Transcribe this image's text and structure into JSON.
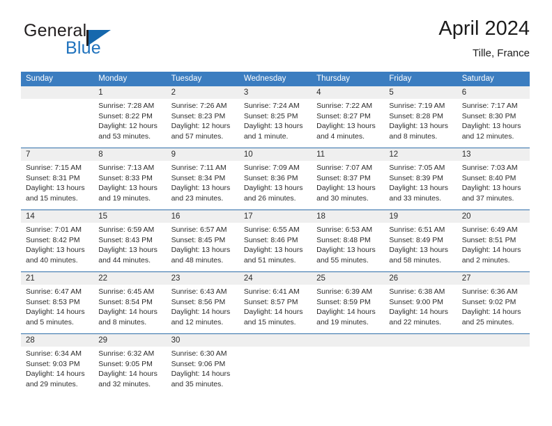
{
  "brand": {
    "name_top": "General",
    "name_bottom": "Blue",
    "accent_color": "#1f72bd"
  },
  "header": {
    "month_title": "April 2024",
    "location": "Tille, France"
  },
  "calendar": {
    "header_color": "#3b7dc0",
    "daynum_strip_color": "#efefef",
    "weekday_names": [
      "Sunday",
      "Monday",
      "Tuesday",
      "Wednesday",
      "Thursday",
      "Friday",
      "Saturday"
    ],
    "weeks": [
      {
        "days": [
          {
            "num": "",
            "lines": []
          },
          {
            "num": "1",
            "lines": [
              "Sunrise: 7:28 AM",
              "Sunset: 8:22 PM",
              "Daylight: 12 hours",
              "and 53 minutes."
            ]
          },
          {
            "num": "2",
            "lines": [
              "Sunrise: 7:26 AM",
              "Sunset: 8:23 PM",
              "Daylight: 12 hours",
              "and 57 minutes."
            ]
          },
          {
            "num": "3",
            "lines": [
              "Sunrise: 7:24 AM",
              "Sunset: 8:25 PM",
              "Daylight: 13 hours",
              "and 1 minute."
            ]
          },
          {
            "num": "4",
            "lines": [
              "Sunrise: 7:22 AM",
              "Sunset: 8:27 PM",
              "Daylight: 13 hours",
              "and 4 minutes."
            ]
          },
          {
            "num": "5",
            "lines": [
              "Sunrise: 7:19 AM",
              "Sunset: 8:28 PM",
              "Daylight: 13 hours",
              "and 8 minutes."
            ]
          },
          {
            "num": "6",
            "lines": [
              "Sunrise: 7:17 AM",
              "Sunset: 8:30 PM",
              "Daylight: 13 hours",
              "and 12 minutes."
            ]
          }
        ]
      },
      {
        "days": [
          {
            "num": "7",
            "lines": [
              "Sunrise: 7:15 AM",
              "Sunset: 8:31 PM",
              "Daylight: 13 hours",
              "and 15 minutes."
            ]
          },
          {
            "num": "8",
            "lines": [
              "Sunrise: 7:13 AM",
              "Sunset: 8:33 PM",
              "Daylight: 13 hours",
              "and 19 minutes."
            ]
          },
          {
            "num": "9",
            "lines": [
              "Sunrise: 7:11 AM",
              "Sunset: 8:34 PM",
              "Daylight: 13 hours",
              "and 23 minutes."
            ]
          },
          {
            "num": "10",
            "lines": [
              "Sunrise: 7:09 AM",
              "Sunset: 8:36 PM",
              "Daylight: 13 hours",
              "and 26 minutes."
            ]
          },
          {
            "num": "11",
            "lines": [
              "Sunrise: 7:07 AM",
              "Sunset: 8:37 PM",
              "Daylight: 13 hours",
              "and 30 minutes."
            ]
          },
          {
            "num": "12",
            "lines": [
              "Sunrise: 7:05 AM",
              "Sunset: 8:39 PM",
              "Daylight: 13 hours",
              "and 33 minutes."
            ]
          },
          {
            "num": "13",
            "lines": [
              "Sunrise: 7:03 AM",
              "Sunset: 8:40 PM",
              "Daylight: 13 hours",
              "and 37 minutes."
            ]
          }
        ]
      },
      {
        "days": [
          {
            "num": "14",
            "lines": [
              "Sunrise: 7:01 AM",
              "Sunset: 8:42 PM",
              "Daylight: 13 hours",
              "and 40 minutes."
            ]
          },
          {
            "num": "15",
            "lines": [
              "Sunrise: 6:59 AM",
              "Sunset: 8:43 PM",
              "Daylight: 13 hours",
              "and 44 minutes."
            ]
          },
          {
            "num": "16",
            "lines": [
              "Sunrise: 6:57 AM",
              "Sunset: 8:45 PM",
              "Daylight: 13 hours",
              "and 48 minutes."
            ]
          },
          {
            "num": "17",
            "lines": [
              "Sunrise: 6:55 AM",
              "Sunset: 8:46 PM",
              "Daylight: 13 hours",
              "and 51 minutes."
            ]
          },
          {
            "num": "18",
            "lines": [
              "Sunrise: 6:53 AM",
              "Sunset: 8:48 PM",
              "Daylight: 13 hours",
              "and 55 minutes."
            ]
          },
          {
            "num": "19",
            "lines": [
              "Sunrise: 6:51 AM",
              "Sunset: 8:49 PM",
              "Daylight: 13 hours",
              "and 58 minutes."
            ]
          },
          {
            "num": "20",
            "lines": [
              "Sunrise: 6:49 AM",
              "Sunset: 8:51 PM",
              "Daylight: 14 hours",
              "and 2 minutes."
            ]
          }
        ]
      },
      {
        "days": [
          {
            "num": "21",
            "lines": [
              "Sunrise: 6:47 AM",
              "Sunset: 8:53 PM",
              "Daylight: 14 hours",
              "and 5 minutes."
            ]
          },
          {
            "num": "22",
            "lines": [
              "Sunrise: 6:45 AM",
              "Sunset: 8:54 PM",
              "Daylight: 14 hours",
              "and 8 minutes."
            ]
          },
          {
            "num": "23",
            "lines": [
              "Sunrise: 6:43 AM",
              "Sunset: 8:56 PM",
              "Daylight: 14 hours",
              "and 12 minutes."
            ]
          },
          {
            "num": "24",
            "lines": [
              "Sunrise: 6:41 AM",
              "Sunset: 8:57 PM",
              "Daylight: 14 hours",
              "and 15 minutes."
            ]
          },
          {
            "num": "25",
            "lines": [
              "Sunrise: 6:39 AM",
              "Sunset: 8:59 PM",
              "Daylight: 14 hours",
              "and 19 minutes."
            ]
          },
          {
            "num": "26",
            "lines": [
              "Sunrise: 6:38 AM",
              "Sunset: 9:00 PM",
              "Daylight: 14 hours",
              "and 22 minutes."
            ]
          },
          {
            "num": "27",
            "lines": [
              "Sunrise: 6:36 AM",
              "Sunset: 9:02 PM",
              "Daylight: 14 hours",
              "and 25 minutes."
            ]
          }
        ]
      },
      {
        "days": [
          {
            "num": "28",
            "lines": [
              "Sunrise: 6:34 AM",
              "Sunset: 9:03 PM",
              "Daylight: 14 hours",
              "and 29 minutes."
            ]
          },
          {
            "num": "29",
            "lines": [
              "Sunrise: 6:32 AM",
              "Sunset: 9:05 PM",
              "Daylight: 14 hours",
              "and 32 minutes."
            ]
          },
          {
            "num": "30",
            "lines": [
              "Sunrise: 6:30 AM",
              "Sunset: 9:06 PM",
              "Daylight: 14 hours",
              "and 35 minutes."
            ]
          },
          {
            "num": "",
            "lines": []
          },
          {
            "num": "",
            "lines": []
          },
          {
            "num": "",
            "lines": []
          },
          {
            "num": "",
            "lines": []
          }
        ]
      }
    ]
  }
}
